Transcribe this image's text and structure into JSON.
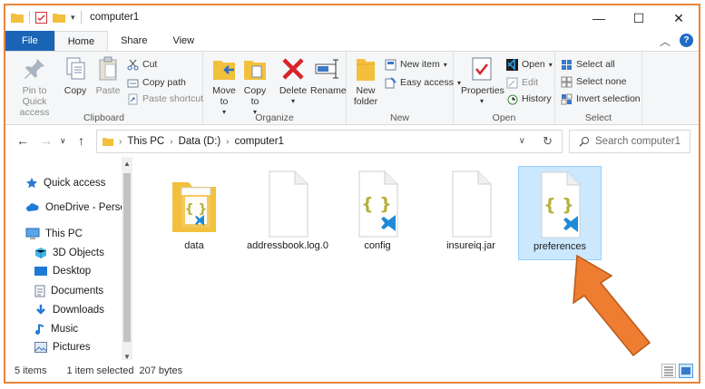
{
  "window": {
    "title": "computer1",
    "controls": {
      "minimize": "—",
      "maximize": "☐",
      "close": "✕"
    }
  },
  "ribbon_tabs": [
    "File",
    "Home",
    "Share",
    "View"
  ],
  "ribbon": {
    "clipboard": {
      "label": "Clipboard",
      "pin_label": "Pin to Quick access",
      "copy_label": "Copy",
      "paste_label": "Paste",
      "cut_label": "Cut",
      "copy_path_label": "Copy path",
      "paste_shortcut_label": "Paste shortcut"
    },
    "organize": {
      "label": "Organize",
      "move_label": "Move to",
      "copy_to_label": "Copy to",
      "delete_label": "Delete",
      "rename_label": "Rename"
    },
    "new": {
      "label": "New",
      "new_folder_label": "New folder",
      "new_item_label": "New item",
      "easy_access_label": "Easy access"
    },
    "open": {
      "label": "Open",
      "properties_label": "Properties",
      "open_label": "Open",
      "edit_label": "Edit",
      "history_label": "History"
    },
    "select": {
      "label": "Select",
      "select_all_label": "Select all",
      "select_none_label": "Select none",
      "invert_label": "Invert selection"
    }
  },
  "address": {
    "crumbs": [
      "This PC",
      "Data (D:)",
      "computer1"
    ],
    "search_placeholder": "Search computer1"
  },
  "nav_pane": {
    "items": [
      {
        "label": "Quick access",
        "icon": "star-icon"
      },
      {
        "label": "OneDrive - Person",
        "icon": "cloud-icon"
      },
      {
        "label": "This PC",
        "icon": "computer-icon"
      },
      {
        "label": "3D Objects",
        "icon": "cube-icon"
      },
      {
        "label": "Desktop",
        "icon": "desktop-icon"
      },
      {
        "label": "Documents",
        "icon": "document-icon"
      },
      {
        "label": "Downloads",
        "icon": "download-icon"
      },
      {
        "label": "Music",
        "icon": "music-icon"
      },
      {
        "label": "Pictures",
        "icon": "picture-icon"
      }
    ]
  },
  "files": [
    {
      "name": "data",
      "type": "folder-vscode",
      "selected": false
    },
    {
      "name": "addressbook.log.0",
      "type": "blank",
      "selected": false
    },
    {
      "name": "config",
      "type": "json-vscode",
      "selected": false
    },
    {
      "name": "insureiq.jar",
      "type": "blank",
      "selected": false
    },
    {
      "name": "preferences",
      "type": "json-vscode",
      "selected": true
    }
  ],
  "status": {
    "item_count": "5 items",
    "selection": "1 item selected",
    "size": "207 bytes"
  },
  "colors": {
    "accent": "#1a64b6",
    "selection_bg": "#cce8ff",
    "annotation_arrow": "#ee7d31",
    "window_border": "#e8853a"
  }
}
